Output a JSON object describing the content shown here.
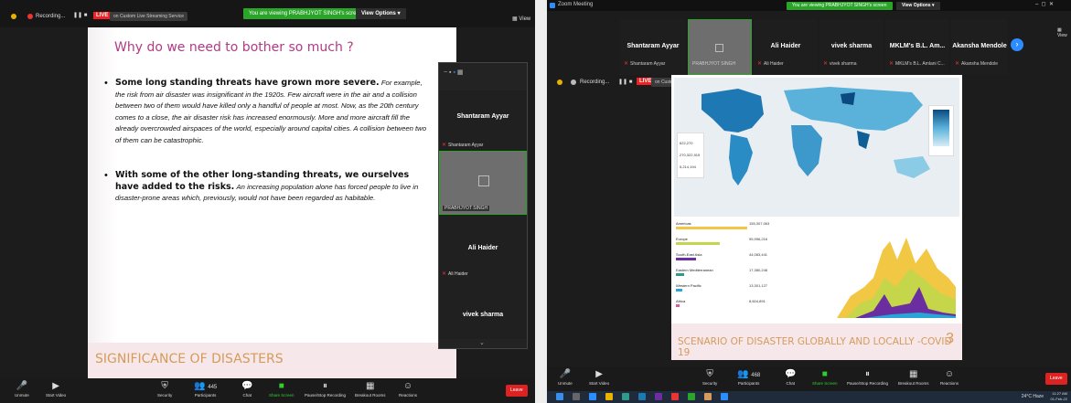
{
  "left_window": {
    "banner": "You are viewing PRABHJYOT SINGH's screen",
    "view_options": "View Options",
    "recording": "Recording...",
    "live": "LIVE",
    "stream_label": "on Custom Live Streaming Service",
    "view": "View",
    "slide": {
      "title": "Why do we need to bother so much ?",
      "bullet1_lead": "Some long standing threats have grown more severe.",
      "bullet1_body": "For example, the risk from air disaster was insignificant in the 1920s. Few aircraft were in the air and a collision between two of them would have killed only a handful of people at most. Now, as the 20th century comes to a close, the air disaster risk has increased enormously. More and more aircraft fill the already overcrowded airspaces of the world, especially around capital cities. A collision between two of them can be catastrophic.",
      "bullet2_lead": "With some of the other long-standing threats, we ourselves have added to the risks.",
      "bullet2_body": "An increasing population alone has forced people to live in disaster-prone areas which, previously, would not have been regarded as habitable.",
      "footer": "SIGNIFICANCE OF DISASTERS"
    },
    "participants": {
      "p1_name": "Shantaram Ayyar",
      "p1_sub": "Shantaram Ayyar",
      "p2_sub": "PRABHJYOT SINGH",
      "p3_name": "Ali Haider",
      "p3_sub": "Ali Haider",
      "p4_name": "vivek sharma"
    },
    "toolbar": {
      "unmute": "Unmute",
      "start_video": "Start Video",
      "security": "Security",
      "participants": "Participants",
      "participant_count": "445",
      "chat": "Chat",
      "share_screen": "Share Screen",
      "pause_recording": "Pause/Stop Recording",
      "breakout": "Breakout Rooms",
      "reactions": "Reactions",
      "leave": "Leave"
    }
  },
  "right_window": {
    "title": "Zoom Meeting",
    "banner": "You are viewing PRABHJYOT SINGH's screen",
    "view_options": "View Options",
    "recording": "Recording...",
    "live": "LIVE",
    "stream_label": "on Custom Live Streaming Service",
    "view": "View",
    "strip": [
      {
        "name": "Shantaram Ayyar",
        "sub": "Shantaram Ayyar"
      },
      {
        "name": "",
        "sub": "PRABHJYOT SINGH"
      },
      {
        "name": "Ali Haider",
        "sub": "Ali Haider"
      },
      {
        "name": "vivek sharma",
        "sub": "vivek sharma"
      },
      {
        "name": "MKLM's B.L. Am...",
        "sub": "MKLM's B.L. Amlani C..."
      },
      {
        "name": "Akansha Mendole",
        "sub": "Akansha Mendole"
      }
    ],
    "slide": {
      "stats": [
        "622,270",
        "270,322,915",
        "5,214,194"
      ],
      "regions": [
        {
          "name": "Americas",
          "value": "155,307,063",
          "color": "#f2c744"
        },
        {
          "name": "Europe",
          "value": "95,996,216",
          "color": "#c5d64a"
        },
        {
          "name": "South-East Asia",
          "value": "44,083,441",
          "color": "#6a2ea0"
        },
        {
          "name": "Eastern Mediterranean",
          "value": "17,380,248",
          "color": "#2f9a8a"
        },
        {
          "name": "Western Pacific",
          "value": "13,301,127",
          "color": "#29a6d6"
        },
        {
          "name": "Africa",
          "value": "8,604,891",
          "color": "#e05aa0"
        }
      ],
      "footer": "SCENARIO OF DISASTER GLOBALLY AND LOCALLY -COVID 19",
      "page_number": "3"
    },
    "toolbar": {
      "unmute": "Unmute",
      "start_video": "Start Video",
      "security": "Security",
      "participants": "Participants",
      "participant_count": "468",
      "chat": "Chat",
      "share_screen": "Share Screen",
      "pause_recording": "Pause/Stop Recording",
      "breakout": "Breakout Rooms",
      "reactions": "Reactions",
      "leave": "Leave"
    },
    "taskbar": {
      "weather": "24°C Haze",
      "time": "11:27 AM",
      "date": "01-Feb-22"
    }
  }
}
